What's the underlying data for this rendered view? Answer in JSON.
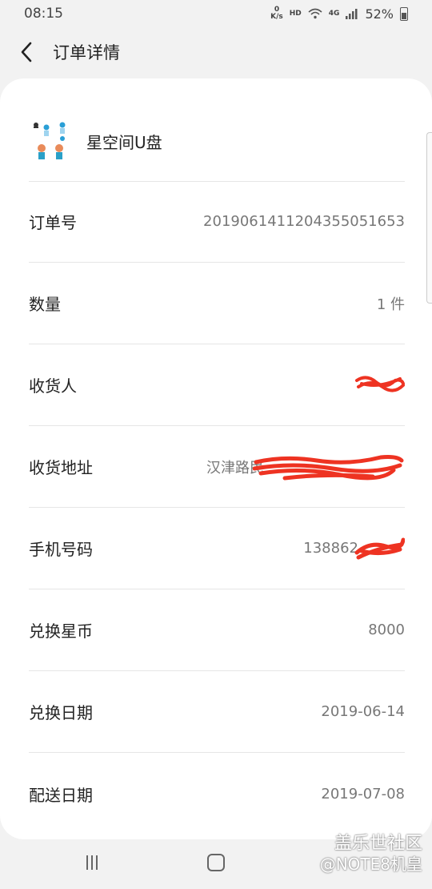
{
  "status_bar": {
    "time": "08:15",
    "net_speed_top": "0",
    "net_speed_unit": "K/s",
    "hd": "HD",
    "network_type": "4G",
    "battery": "52%"
  },
  "header": {
    "title": "订单详情",
    "back_icon": "chevron-left-icon"
  },
  "product": {
    "name": "星空间U盘"
  },
  "rows": [
    {
      "label": "订单号",
      "value": "2019061411204355051653"
    },
    {
      "label": "数量",
      "value": "1 件"
    },
    {
      "label": "收货人",
      "value": ""
    },
    {
      "label": "收货地址",
      "value": "汉津路民"
    },
    {
      "label": "手机号码",
      "value": "138862"
    },
    {
      "label": "兑换星币",
      "value": "8000"
    },
    {
      "label": "兑换日期",
      "value": "2019-06-14"
    },
    {
      "label": "配送日期",
      "value": "2019-07-08"
    }
  ],
  "watermark": {
    "line1": "盖乐世社区",
    "line2": "@NOTE8机皇"
  },
  "colors": {
    "background": "#f2f2f2",
    "card": "#ffffff",
    "redaction": "#ee3322"
  }
}
